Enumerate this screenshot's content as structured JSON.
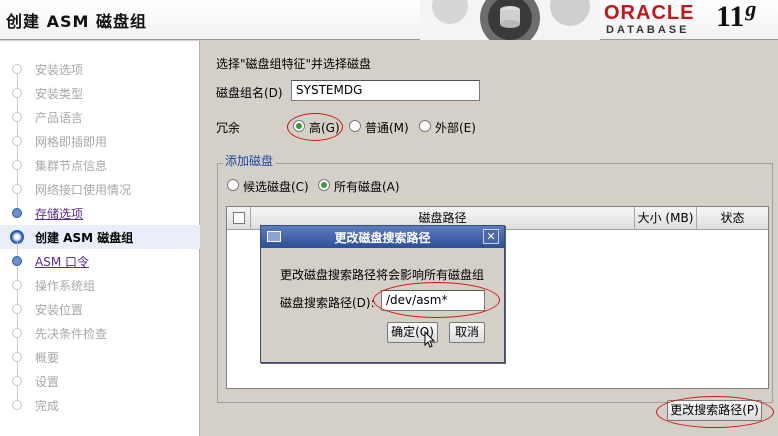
{
  "header": {
    "title": "创建 ASM 磁盘组",
    "oracle": "ORACLE",
    "database": "DATABASE",
    "version": "11",
    "version_suffix": "g"
  },
  "nav": {
    "items": [
      {
        "label": "安装选项",
        "state": "disabled"
      },
      {
        "label": "安装类型",
        "state": "disabled"
      },
      {
        "label": "产品语言",
        "state": "disabled"
      },
      {
        "label": "网格即插即用",
        "state": "disabled"
      },
      {
        "label": "集群节点信息",
        "state": "disabled"
      },
      {
        "label": "网络接口使用情况",
        "state": "disabled"
      },
      {
        "label": "存储选项",
        "state": "link"
      },
      {
        "label": "创建 ASM 磁盘组",
        "state": "active"
      },
      {
        "label": "ASM 口令",
        "state": "link"
      },
      {
        "label": "操作系统组",
        "state": "disabled"
      },
      {
        "label": "安装位置",
        "state": "disabled"
      },
      {
        "label": "先决条件检查",
        "state": "disabled"
      },
      {
        "label": "概要",
        "state": "disabled"
      },
      {
        "label": "设置",
        "state": "disabled"
      },
      {
        "label": "完成",
        "state": "disabled"
      }
    ]
  },
  "main": {
    "instruction": "选择\"磁盘组特征\"并选择磁盘",
    "diskgroup_label": "磁盘组名(D)",
    "diskgroup_value": "SYSTEMDG",
    "redundancy_label": "冗余",
    "redundancy_options": [
      {
        "label": "高(G)",
        "selected": true
      },
      {
        "label": "普通(M)",
        "selected": false
      },
      {
        "label": "外部(E)",
        "selected": false
      }
    ],
    "add_disks_title": "添加磁盘",
    "disk_filter_options": [
      {
        "label": "候选磁盘(C)",
        "selected": false
      },
      {
        "label": "所有磁盘(A)",
        "selected": true
      }
    ],
    "table_headers": [
      "磁盘路径",
      "大小 (MB)",
      "状态"
    ],
    "change_path_button": "更改搜索路径(P)"
  },
  "dialog": {
    "title": "更改磁盘搜索路径",
    "message": "更改磁盘搜索路径将会影响所有磁盘组",
    "path_label": "磁盘搜索路径(D):",
    "path_value": "/dev/asm*",
    "ok_button": "确定(O)",
    "cancel_button": "取消",
    "close_glyph": "✕"
  },
  "colors": {
    "annotation_red": "#d21414",
    "oracle_red": "#c4161c",
    "titlebar_blue": "#2f4f95",
    "selected_radio": "#3a9a3a"
  }
}
